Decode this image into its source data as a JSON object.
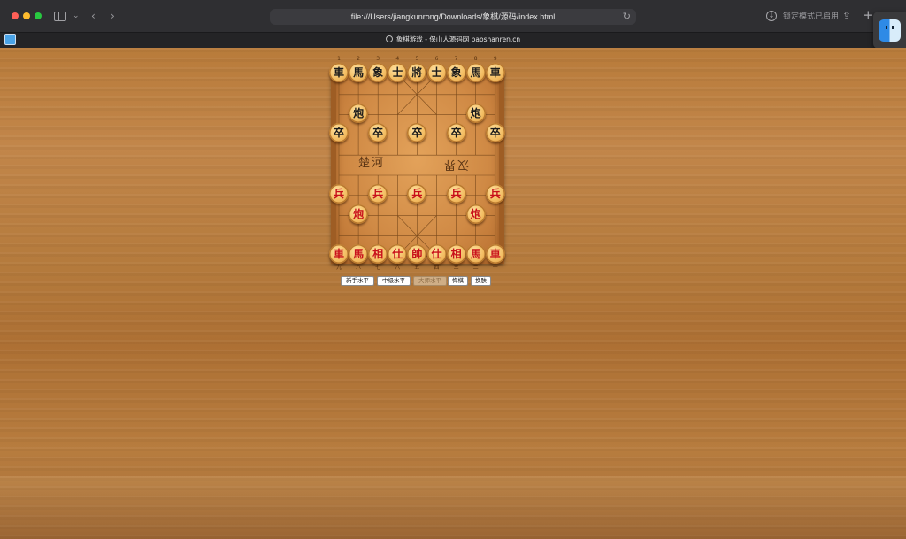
{
  "browser": {
    "address": "file:///Users/jiangkunrong/Downloads/象棋/源码/index.html",
    "lock_mode": "锁定模式已启用",
    "tab_title": "象棋游戏 - 保山人源码网 baoshanren.cn"
  },
  "board": {
    "top_files": [
      "1",
      "2",
      "3",
      "4",
      "5",
      "6",
      "7",
      "8",
      "9"
    ],
    "bottom_files": [
      "九",
      "八",
      "七",
      "六",
      "五",
      "四",
      "三",
      "二",
      "一"
    ],
    "river_left": "楚河",
    "river_right": "汉界",
    "pieces": [
      {
        "t": "車",
        "c": "black",
        "col": 0,
        "row": 0
      },
      {
        "t": "馬",
        "c": "black",
        "col": 1,
        "row": 0
      },
      {
        "t": "象",
        "c": "black",
        "col": 2,
        "row": 0
      },
      {
        "t": "士",
        "c": "black",
        "col": 3,
        "row": 0
      },
      {
        "t": "將",
        "c": "black",
        "col": 4,
        "row": 0
      },
      {
        "t": "士",
        "c": "black",
        "col": 5,
        "row": 0
      },
      {
        "t": "象",
        "c": "black",
        "col": 6,
        "row": 0
      },
      {
        "t": "馬",
        "c": "black",
        "col": 7,
        "row": 0
      },
      {
        "t": "車",
        "c": "black",
        "col": 8,
        "row": 0
      },
      {
        "t": "炮",
        "c": "black",
        "col": 1,
        "row": 2
      },
      {
        "t": "炮",
        "c": "black",
        "col": 7,
        "row": 2
      },
      {
        "t": "卒",
        "c": "black",
        "col": 0,
        "row": 3
      },
      {
        "t": "卒",
        "c": "black",
        "col": 2,
        "row": 3
      },
      {
        "t": "卒",
        "c": "black",
        "col": 4,
        "row": 3
      },
      {
        "t": "卒",
        "c": "black",
        "col": 6,
        "row": 3
      },
      {
        "t": "卒",
        "c": "black",
        "col": 8,
        "row": 3
      },
      {
        "t": "兵",
        "c": "red",
        "col": 0,
        "row": 6
      },
      {
        "t": "兵",
        "c": "red",
        "col": 2,
        "row": 6
      },
      {
        "t": "兵",
        "c": "red",
        "col": 4,
        "row": 6
      },
      {
        "t": "兵",
        "c": "red",
        "col": 6,
        "row": 6
      },
      {
        "t": "兵",
        "c": "red",
        "col": 8,
        "row": 6
      },
      {
        "t": "炮",
        "c": "red",
        "col": 1,
        "row": 7
      },
      {
        "t": "炮",
        "c": "red",
        "col": 7,
        "row": 7
      },
      {
        "t": "車",
        "c": "red",
        "col": 0,
        "row": 9
      },
      {
        "t": "馬",
        "c": "red",
        "col": 1,
        "row": 9
      },
      {
        "t": "相",
        "c": "red",
        "col": 2,
        "row": 9
      },
      {
        "t": "仕",
        "c": "red",
        "col": 3,
        "row": 9
      },
      {
        "t": "帥",
        "c": "red",
        "col": 4,
        "row": 9
      },
      {
        "t": "仕",
        "c": "red",
        "col": 5,
        "row": 9
      },
      {
        "t": "相",
        "c": "red",
        "col": 6,
        "row": 9
      },
      {
        "t": "馬",
        "c": "red",
        "col": 7,
        "row": 9
      },
      {
        "t": "車",
        "c": "red",
        "col": 8,
        "row": 9
      }
    ]
  },
  "controls": {
    "novice": "新手水平",
    "intermediate": "中级水平",
    "master": "大师水平",
    "undo": "悔棋",
    "skin": "换肤"
  }
}
